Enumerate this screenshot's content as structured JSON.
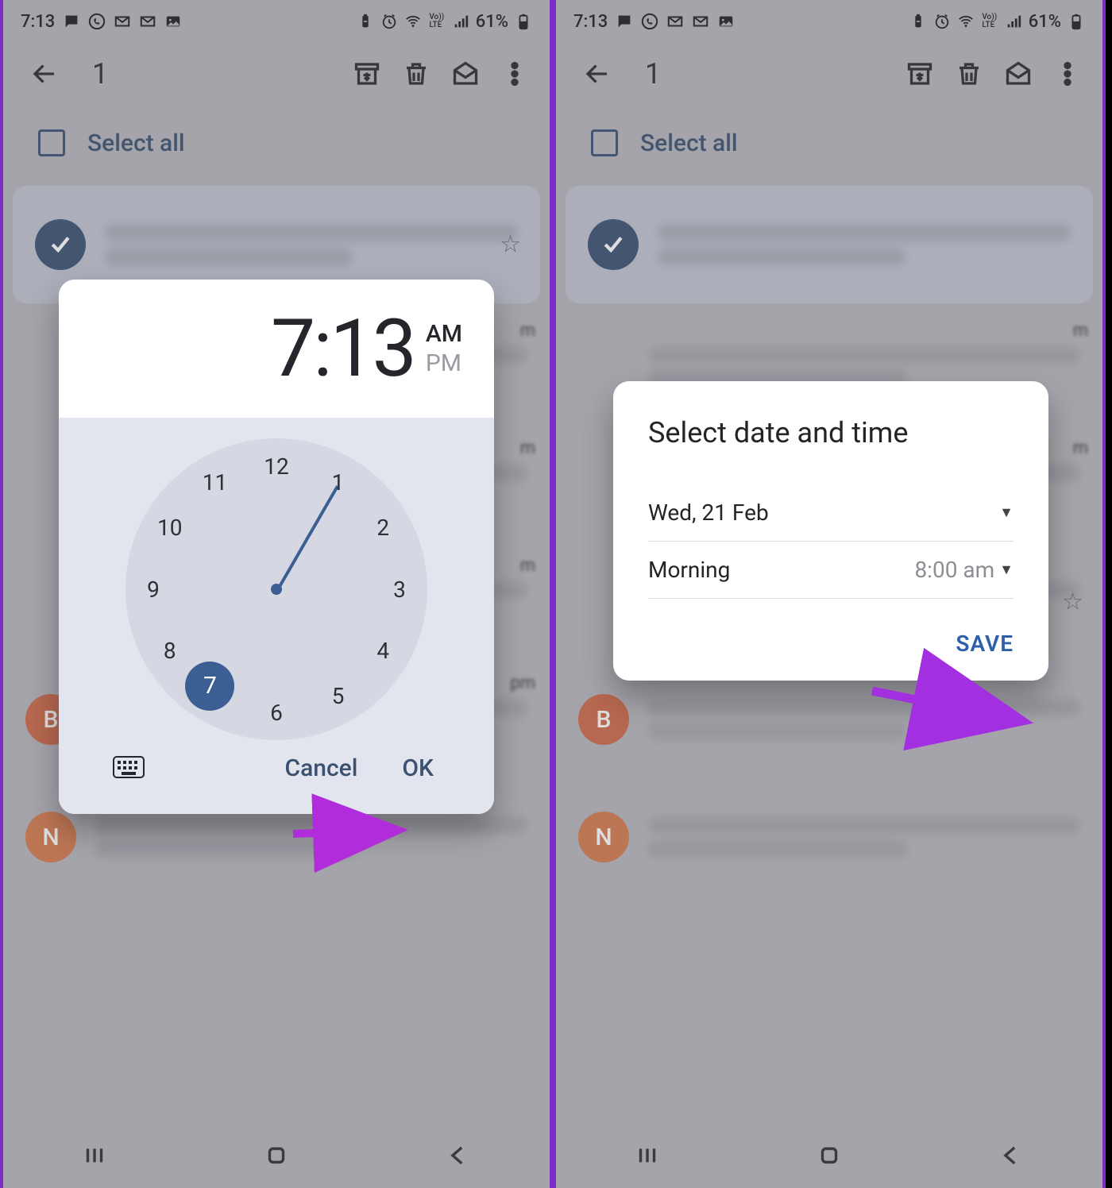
{
  "statusbar": {
    "time": "7:13",
    "battery_pct": "61%"
  },
  "toolbar": {
    "selected_count": "1"
  },
  "select_all_label": "Select all",
  "avatars": {
    "b": "B",
    "n": "N"
  },
  "time_picker": {
    "hour": "7",
    "colon": ":",
    "minute": "13",
    "am": "AM",
    "pm": "PM",
    "selected_ampm": "AM",
    "numbers": [
      "12",
      "1",
      "2",
      "3",
      "4",
      "5",
      "6",
      "7",
      "8",
      "9",
      "10",
      "11"
    ],
    "selected_hour": "7",
    "cancel": "Cancel",
    "ok": "OK"
  },
  "datetime_dialog": {
    "title": "Select date and time",
    "date_label": "Wed, 21 Feb",
    "time_period_label": "Morning",
    "time_value": "8:00 am",
    "save": "SAVE"
  },
  "arrow_colors": {
    "time": "#b12ddb",
    "save": "#a22fe0"
  }
}
